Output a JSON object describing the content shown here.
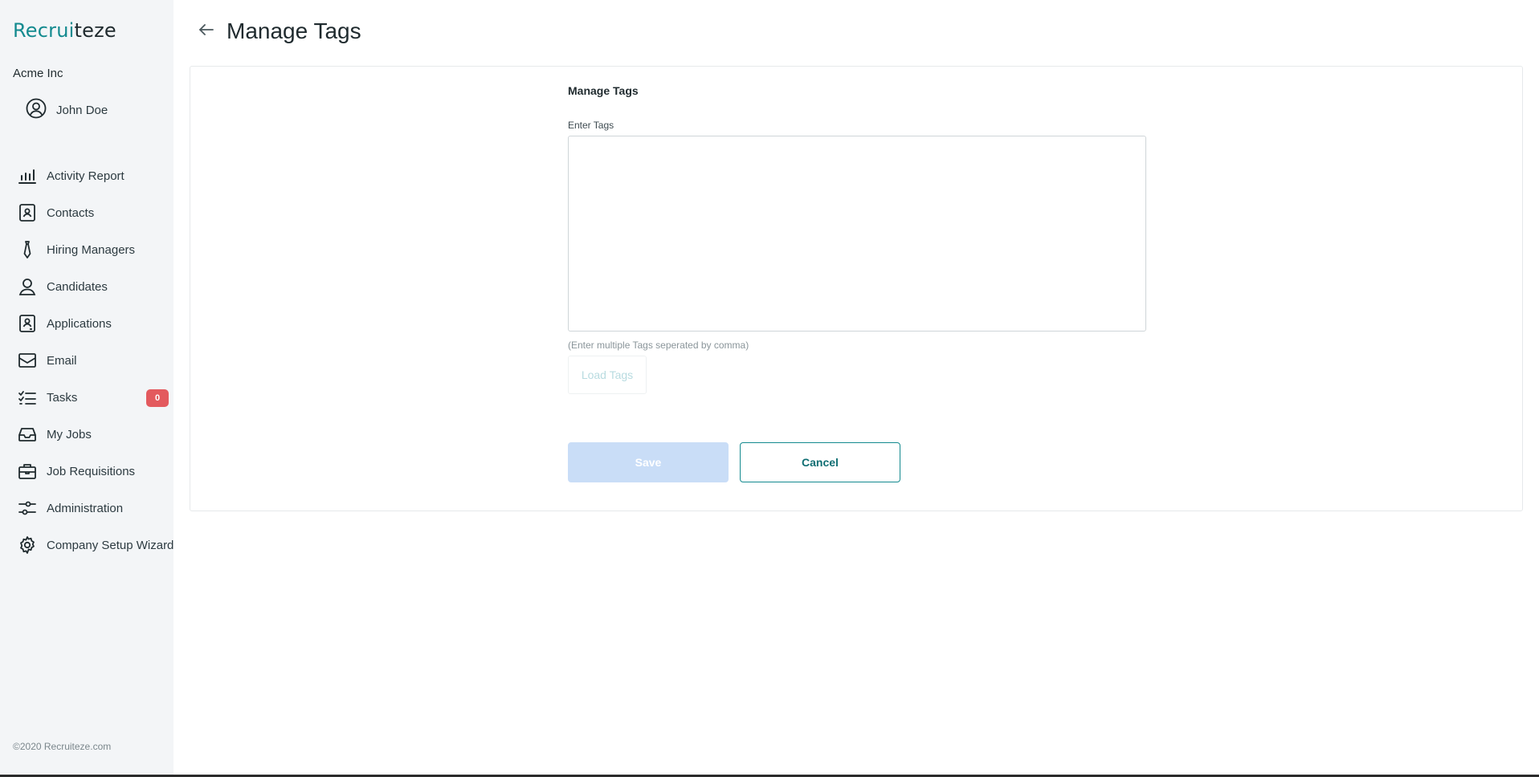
{
  "brand": {
    "logo_part1": "Recrui",
    "logo_part2": "teze",
    "accent_color": "#138a8f"
  },
  "sidebar": {
    "company": "Acme Inc",
    "user": {
      "name": "John Doe",
      "icon": "user-circle-icon"
    },
    "items": [
      {
        "label": "Activity Report",
        "icon": "bar-chart-icon"
      },
      {
        "label": "Contacts",
        "icon": "contact-book-icon"
      },
      {
        "label": "Hiring Managers",
        "icon": "tie-icon"
      },
      {
        "label": "Candidates",
        "icon": "person-icon"
      },
      {
        "label": "Applications",
        "icon": "application-icon"
      },
      {
        "label": "Email",
        "icon": "mail-icon"
      },
      {
        "label": "Tasks",
        "icon": "task-list-icon",
        "badge": "0"
      },
      {
        "label": "My Jobs",
        "icon": "inbox-icon"
      },
      {
        "label": "Job Requisitions",
        "icon": "briefcase-icon"
      },
      {
        "label": "Administration",
        "icon": "sliders-icon"
      },
      {
        "label": "Company Setup Wizard",
        "icon": "gear-icon"
      }
    ],
    "copyright": "©2020 Recruiteze.com"
  },
  "header": {
    "title": "Manage Tags",
    "back_icon": "arrow-left-icon"
  },
  "form": {
    "title": "Manage Tags",
    "tags_label": "Enter Tags",
    "tags_value": "",
    "hint": "(Enter multiple Tags seperated by comma)",
    "load_button": "Load Tags",
    "save_button": "Save",
    "cancel_button": "Cancel"
  }
}
